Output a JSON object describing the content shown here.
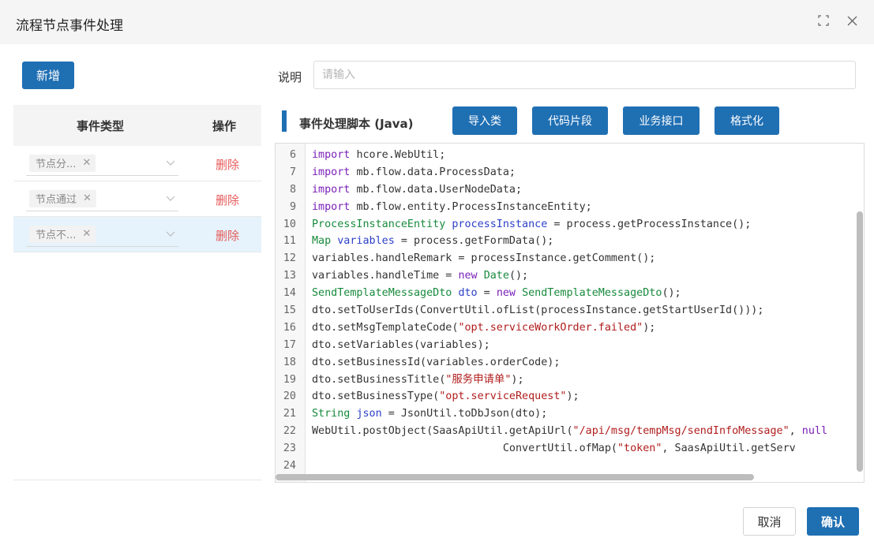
{
  "dialog": {
    "title": "流程节点事件处理",
    "icons": [
      "fullscreen-icon",
      "close-icon"
    ]
  },
  "colors": {
    "primary": "#1f6fb3",
    "danger": "#e65b5b",
    "selected_row": "#e6f3fc"
  },
  "left": {
    "add_label": "新增",
    "columns": {
      "type": "事件类型",
      "op": "操作"
    },
    "rows": [
      {
        "tag": "节点分...",
        "delete": "删除",
        "selected": false
      },
      {
        "tag": "节点通过",
        "delete": "删除",
        "selected": false
      },
      {
        "tag": "节点不...",
        "delete": "删除",
        "selected": true
      }
    ]
  },
  "description": {
    "label": "说明",
    "placeholder": "请输入",
    "value": ""
  },
  "script": {
    "title": "事件处理脚本 (Java)",
    "buttons": [
      "导入类",
      "代码片段",
      "业务接口",
      "格式化"
    ]
  },
  "code": {
    "lines": [
      {
        "n": "6",
        "segs": [
          [
            "kw",
            "import"
          ],
          [
            "",
            "hcore.WebUtil;"
          ]
        ]
      },
      {
        "n": "7",
        "segs": [
          [
            "kw",
            "import"
          ],
          [
            "",
            "mb.flow.data.ProcessData;"
          ]
        ]
      },
      {
        "n": "8",
        "segs": [
          [
            "kw",
            "import"
          ],
          [
            "",
            "mb.flow.data.UserNodeData;"
          ]
        ]
      },
      {
        "n": "9",
        "segs": [
          [
            "kw",
            "import"
          ],
          [
            "",
            "mb.flow.entity.ProcessInstanceEntity;"
          ]
        ]
      },
      {
        "n": "10",
        "segs": [
          [
            "ty",
            "ProcessInstanceEntity"
          ],
          [
            "",
            ""
          ],
          [
            "vr",
            "processInstance"
          ],
          [
            "",
            " = process.getProcessInstance();"
          ]
        ]
      },
      {
        "n": "11",
        "segs": [
          [
            "ty",
            "Map"
          ],
          [
            "vr",
            "variables"
          ],
          [
            "",
            " = process.getFormData();"
          ]
        ]
      },
      {
        "n": "12",
        "segs": [
          [
            "",
            "variables.handleRemark = processInstance.getComment();"
          ]
        ]
      },
      {
        "n": "13",
        "segs": [
          [
            "",
            "variables.handleTime = "
          ],
          [
            "kw",
            "new"
          ],
          [
            "ty",
            "Date"
          ],
          [
            "",
            "();"
          ]
        ]
      },
      {
        "n": "14",
        "segs": [
          [
            "ty",
            "SendTemplateMessageDto"
          ],
          [
            "vr",
            "dto"
          ],
          [
            "",
            " = "
          ],
          [
            "kw",
            "new"
          ],
          [
            "ty",
            "SendTemplateMessageDto"
          ],
          [
            "",
            "();"
          ]
        ]
      },
      {
        "n": "15",
        "segs": [
          [
            "",
            "dto.setToUserIds(ConvertUtil.ofList(processInstance.getStartUserId()));"
          ]
        ]
      },
      {
        "n": "16",
        "segs": [
          [
            "",
            "dto.setMsgTemplateCode("
          ],
          [
            "st",
            "\"opt.serviceWorkOrder.failed\""
          ],
          [
            "",
            ");"
          ]
        ]
      },
      {
        "n": "17",
        "segs": [
          [
            "",
            "dto.setVariables(variables);"
          ]
        ]
      },
      {
        "n": "18",
        "segs": [
          [
            "",
            "dto.setBusinessId(variables.orderCode);"
          ]
        ]
      },
      {
        "n": "19",
        "segs": [
          [
            "",
            "dto.setBusinessTitle("
          ],
          [
            "st",
            "\"服务申请单\""
          ],
          [
            "",
            ");"
          ]
        ]
      },
      {
        "n": "20",
        "segs": [
          [
            "",
            "dto.setBusinessType("
          ],
          [
            "st",
            "\"opt.serviceRequest\""
          ],
          [
            "",
            ");"
          ]
        ]
      },
      {
        "n": "21",
        "segs": [
          [
            "ty",
            "String"
          ],
          [
            "vr",
            "json"
          ],
          [
            "",
            " = JsonUtil.toDbJson(dto);"
          ]
        ]
      },
      {
        "n": "22",
        "segs": [
          [
            "",
            "WebUtil.postObject(SaasApiUtil.getApiUrl("
          ],
          [
            "st",
            "\"/api/msg/tempMsg/sendInfoMessage\""
          ],
          [
            "",
            ", "
          ],
          [
            "kw",
            "null"
          ]
        ]
      },
      {
        "n": "23",
        "segs": [
          [
            "",
            "                              ConvertUtil.ofMap("
          ],
          [
            "st",
            "\"token\""
          ],
          [
            "",
            ", SaasApiUtil.getServ"
          ]
        ]
      },
      {
        "n": "24",
        "segs": [
          [
            "",
            ""
          ]
        ]
      }
    ]
  },
  "footer": {
    "cancel": "取消",
    "confirm": "确认"
  }
}
